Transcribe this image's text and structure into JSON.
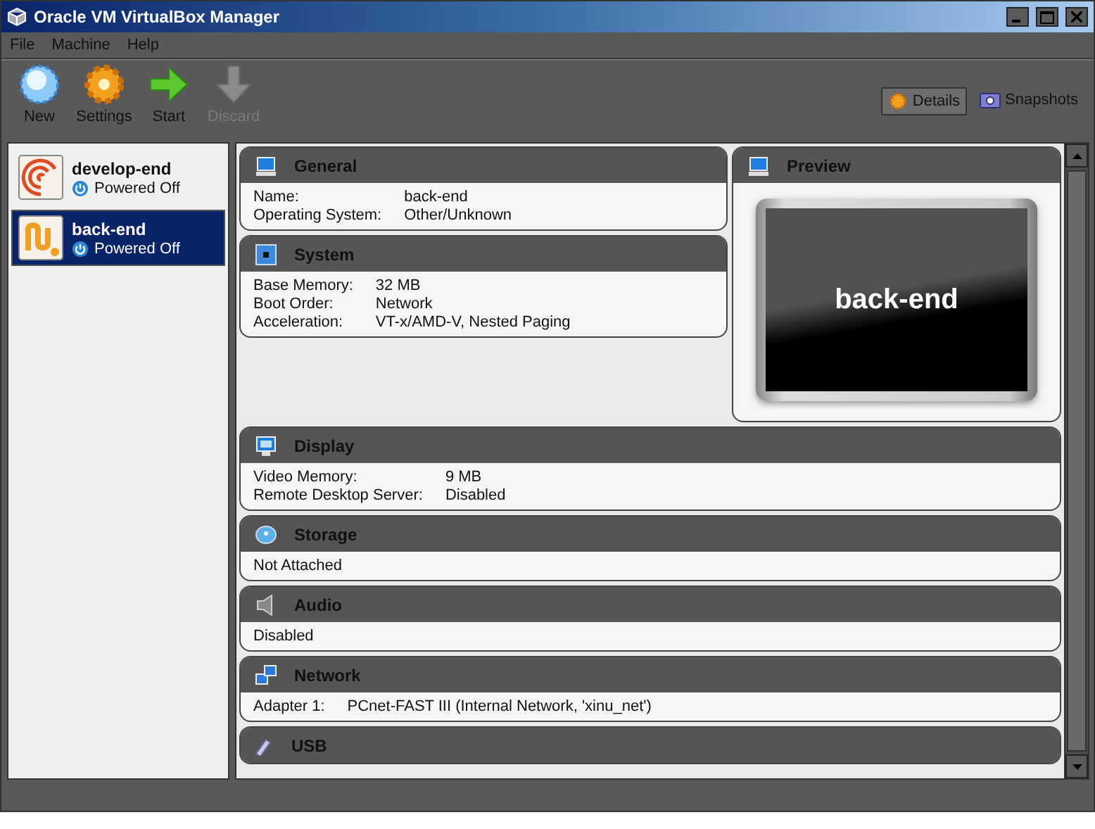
{
  "window": {
    "title": "Oracle VM VirtualBox Manager"
  },
  "menu": [
    "File",
    "Machine",
    "Help"
  ],
  "toolbar": [
    {
      "kind": "new",
      "label": "New",
      "disabled": false
    },
    {
      "kind": "settings",
      "label": "Settings",
      "disabled": false
    },
    {
      "kind": "start",
      "label": "Start",
      "disabled": false
    },
    {
      "kind": "discard",
      "label": "Discard",
      "disabled": true
    }
  ],
  "view_tabs": [
    {
      "kind": "details",
      "label": "Details",
      "selected": true
    },
    {
      "kind": "snapshots",
      "label": "Snapshots",
      "selected": false
    }
  ],
  "vm_list": [
    {
      "kind": "swirl",
      "name": "develop-end",
      "state": "Powered Off",
      "selected": false
    },
    {
      "kind": "hook",
      "name": "back-end",
      "state": "Powered Off",
      "selected": true
    }
  ],
  "top_sections": [
    {
      "kind": "general",
      "title": "General",
      "rows": [
        {
          "label": "Name:",
          "value": "back-end"
        },
        {
          "label": "Operating System:",
          "value": "Other/Unknown"
        }
      ]
    },
    {
      "kind": "system",
      "title": "System",
      "rows": [
        {
          "label": "Base Memory:",
          "value": "32 MB"
        },
        {
          "label": "Boot Order:",
          "value": "Network"
        },
        {
          "label": "Acceleration:",
          "value": "VT-x/AMD-V, Nested Paging"
        }
      ]
    }
  ],
  "preview": {
    "title": "Preview",
    "screen_text": "back-end"
  },
  "sections": [
    {
      "kind": "display",
      "title": "Display",
      "rows": [
        {
          "label": "Video Memory:",
          "value": "9 MB"
        },
        {
          "label": "Remote Desktop Server:",
          "value": "Disabled"
        }
      ]
    },
    {
      "kind": "storage",
      "title": "Storage",
      "text": "Not Attached"
    },
    {
      "kind": "audio",
      "title": "Audio",
      "text": "Disabled"
    },
    {
      "kind": "network",
      "title": "Network",
      "rows": [
        {
          "label": "Adapter 1:",
          "value": "PCnet-FAST III (Internal Network, 'xinu_net')"
        }
      ]
    },
    {
      "kind": "usb",
      "title": "USB"
    }
  ]
}
